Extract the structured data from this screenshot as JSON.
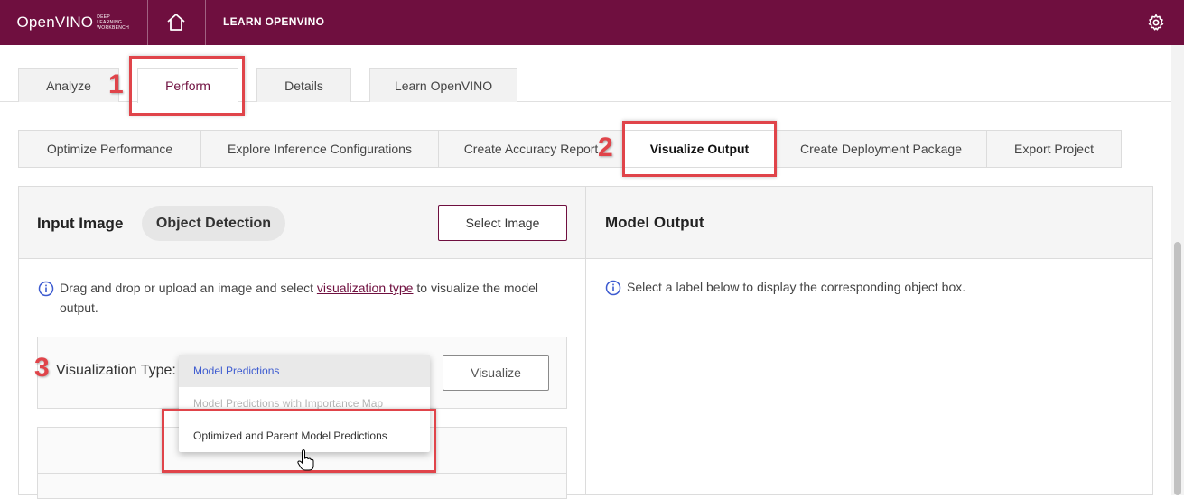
{
  "header": {
    "logo_text": "OpenVINO",
    "logo_subtext_line1": "DEEP LEARNING",
    "logo_subtext_line2": "WORKBENCH",
    "learn_link": "LEARN OPENVINO"
  },
  "tabs": [
    {
      "label": "Analyze",
      "active": false
    },
    {
      "label": "Perform",
      "active": true
    },
    {
      "label": "Details",
      "active": false
    },
    {
      "label": "Learn OpenVINO",
      "active": false
    }
  ],
  "subtabs": [
    {
      "label": "Optimize Performance",
      "active": false
    },
    {
      "label": "Explore Inference Configurations",
      "active": false
    },
    {
      "label": "Create Accuracy Report",
      "active": false
    },
    {
      "label": "Visualize Output",
      "active": true
    },
    {
      "label": "Create Deployment Package",
      "active": false
    },
    {
      "label": "Export Project",
      "active": false
    }
  ],
  "input_panel": {
    "title": "Input Image",
    "chip": "Object Detection",
    "select_button": "Select Image",
    "info_prefix": "Drag and drop or upload an image and select ",
    "info_link": "visualization type",
    "info_suffix_line1": " to visualize the model",
    "info_suffix_line2": "output.",
    "vis_type_label": "Visualization Type:",
    "visualize_button": "Visualize"
  },
  "output_panel": {
    "title": "Model Output",
    "info": "Select a label below to display the corresponding object box."
  },
  "dropdown": {
    "options": [
      {
        "label": "Model Predictions",
        "state": "selected"
      },
      {
        "label": "Model Predictions with Importance Map",
        "state": "disabled"
      },
      {
        "label": "Optimized and Parent Model Predictions",
        "state": "normal"
      }
    ]
  },
  "annotations": [
    "1",
    "2",
    "3"
  ],
  "colors": {
    "brand": "#6f0f3f",
    "annotation": "#e0444a",
    "selected_option": "#3d5bd0"
  }
}
